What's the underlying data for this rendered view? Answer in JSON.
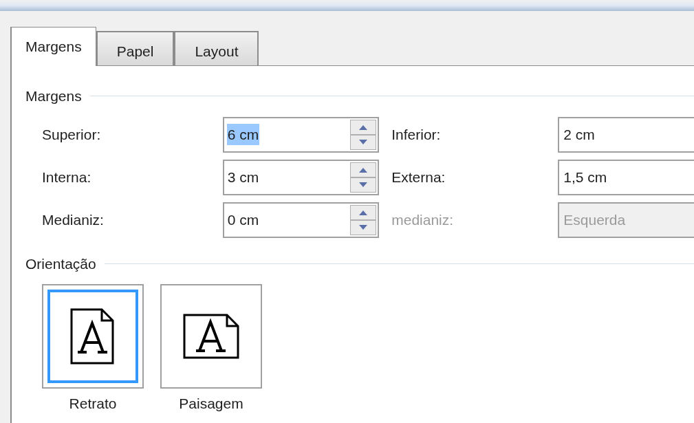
{
  "tabs": [
    {
      "label": "Margens",
      "selected": true
    },
    {
      "label": "Papel",
      "selected": false
    },
    {
      "label": "Layout",
      "selected": false
    }
  ],
  "margins": {
    "heading": "Margens",
    "rows": [
      {
        "left": {
          "label": "Superior:",
          "value": "6 cm",
          "text_selected": true
        },
        "right": {
          "label": "Inferior:",
          "value": "2 cm",
          "disabled": false
        }
      },
      {
        "left": {
          "label": "Interna:",
          "value": "3 cm",
          "text_selected": false
        },
        "right": {
          "label": "Externa:",
          "value": "1,5 cm",
          "disabled": false
        }
      },
      {
        "left": {
          "label": "Medianiz:",
          "value": "0 cm",
          "text_selected": false
        },
        "right": {
          "label": "medianiz:",
          "value": "Esquerda",
          "disabled": true
        }
      }
    ]
  },
  "orientation": {
    "heading": "Orientação",
    "options": [
      {
        "kind": "portrait",
        "label": "Retrato",
        "selected": true
      },
      {
        "kind": "landscape",
        "label": "Paisagem",
        "selected": false
      }
    ]
  }
}
